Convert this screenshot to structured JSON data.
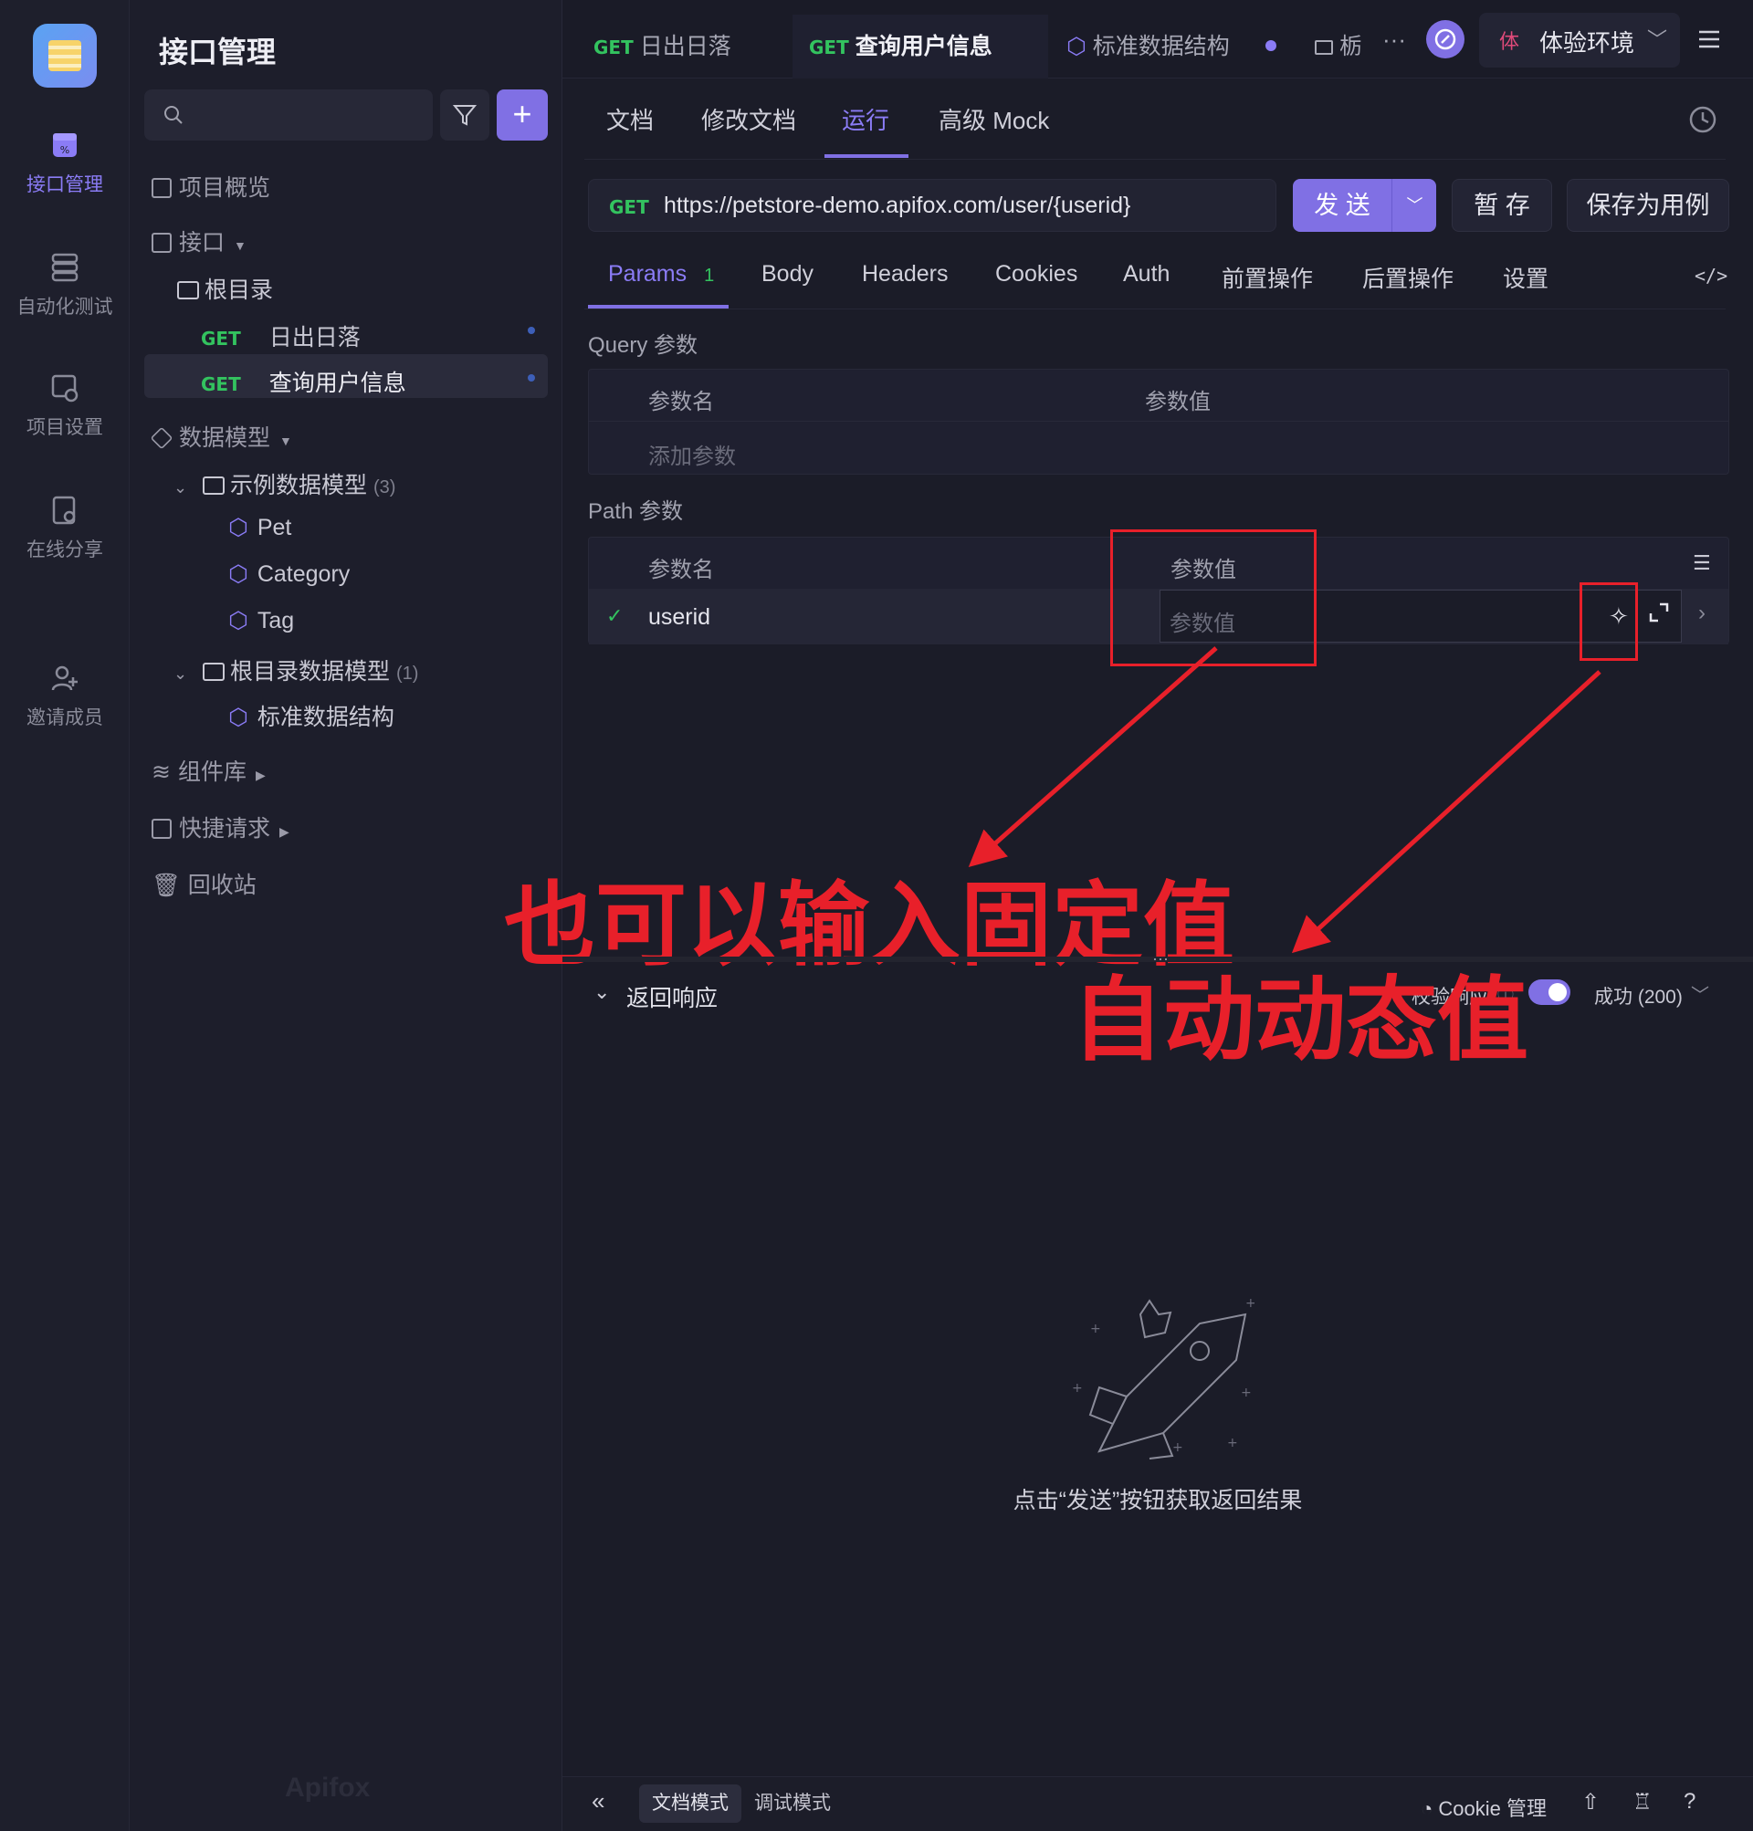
{
  "rail": {
    "items": [
      {
        "label": "接口管理",
        "icon": "api-icon"
      },
      {
        "label": "自动化测试",
        "icon": "automation-icon"
      },
      {
        "label": "项目设置",
        "icon": "project-settings-icon"
      },
      {
        "label": "在线分享",
        "icon": "share-icon"
      },
      {
        "label": "邀请成员",
        "icon": "invite-member-icon"
      }
    ]
  },
  "sidebar": {
    "title": "接口管理",
    "search_placeholder": "",
    "overview": "项目概览",
    "interfaces": "接口",
    "root": "根目录",
    "api_items": [
      {
        "method": "GET",
        "name": "日出日落"
      },
      {
        "method": "GET",
        "name": "查询用户信息"
      }
    ],
    "models": "数据模型",
    "model_folder_1": {
      "name": "示例数据模型",
      "count": "(3)"
    },
    "model_items_1": [
      "Pet",
      "Category",
      "Tag"
    ],
    "model_folder_2": {
      "name": "根目录数据模型",
      "count": "(1)"
    },
    "model_items_2": [
      "标准数据结构"
    ],
    "components": "组件库",
    "quick_requests": "快捷请求",
    "trash": "回收站",
    "brand": "Apifox"
  },
  "tabs": [
    {
      "method": "GET",
      "name": "日出日落"
    },
    {
      "method": "GET",
      "name": "查询用户信息"
    },
    {
      "method": "",
      "name": "标准数据结构"
    },
    {
      "method": "",
      "name": "栃"
    }
  ],
  "env": {
    "badge": "体",
    "name": "体验环境"
  },
  "subtabs": [
    "文档",
    "修改文档",
    "运行",
    "高级 Mock"
  ],
  "request": {
    "method": "GET",
    "url": "https://petstore-demo.apifox.com/user/{userid}",
    "send": "发 送",
    "temp_save": "暂 存",
    "save_case": "保存为用例"
  },
  "param_tabs": [
    {
      "label": "Params",
      "count": "1"
    },
    {
      "label": "Body"
    },
    {
      "label": "Headers"
    },
    {
      "label": "Cookies"
    },
    {
      "label": "Auth"
    },
    {
      "label": "前置操作"
    },
    {
      "label": "后置操作"
    },
    {
      "label": "设置"
    }
  ],
  "query": {
    "title": "Query 参数",
    "col_name": "参数名",
    "col_value": "参数值",
    "add": "添加参数"
  },
  "path": {
    "title": "Path 参数",
    "col_name": "参数名",
    "col_value": "参数值",
    "row_name": "userid",
    "value_placeholder": "参数值"
  },
  "annotations": {
    "fixed": "也可以输入固定值",
    "dynamic": "自动动态值"
  },
  "response": {
    "title": "返回响应",
    "validate": "校验响应",
    "status": "成功 (200)",
    "empty_hint": "点击“发送”按钮获取返回结果"
  },
  "bottom": {
    "doc_mode": "文档模式",
    "debug_mode": "调试模式",
    "cookie": "Cookie 管理"
  },
  "colors": {
    "accent": "#8070e4",
    "get": "#33c35f",
    "annotation": "#e8202a"
  }
}
